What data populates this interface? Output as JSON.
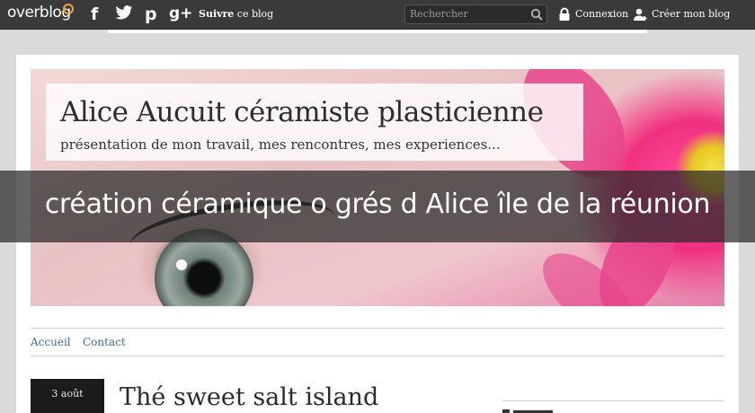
{
  "topbar": {
    "logo": "overblog",
    "social": [
      "f",
      "t",
      "p",
      "g+"
    ],
    "follow_bold": "Suivre",
    "follow_rest": " ce blog",
    "search_placeholder": "Rechercher",
    "login": "Connexion",
    "create": "Créer mon blog"
  },
  "blog": {
    "title": "Alice Aucuit céramiste plasticienne",
    "subtitle": "présentation de mon travail, mes rencontres, mes experiences..."
  },
  "nav": {
    "items": [
      "Accueil",
      "Contact"
    ]
  },
  "post": {
    "date": "3 août",
    "title": "Thé sweet salt island"
  },
  "overlay": {
    "title": "création céramique o grés d Alice île de la réunion"
  },
  "colors": {
    "topbar": "#3a3a3a",
    "link": "#3f6b9b",
    "logo_accent": "#f2a23a",
    "overlay": "#282828"
  },
  "icons": [
    "facebook-icon",
    "twitter-icon",
    "pinterest-icon",
    "google-plus-icon",
    "search-icon",
    "lock-icon",
    "user-add-icon"
  ]
}
